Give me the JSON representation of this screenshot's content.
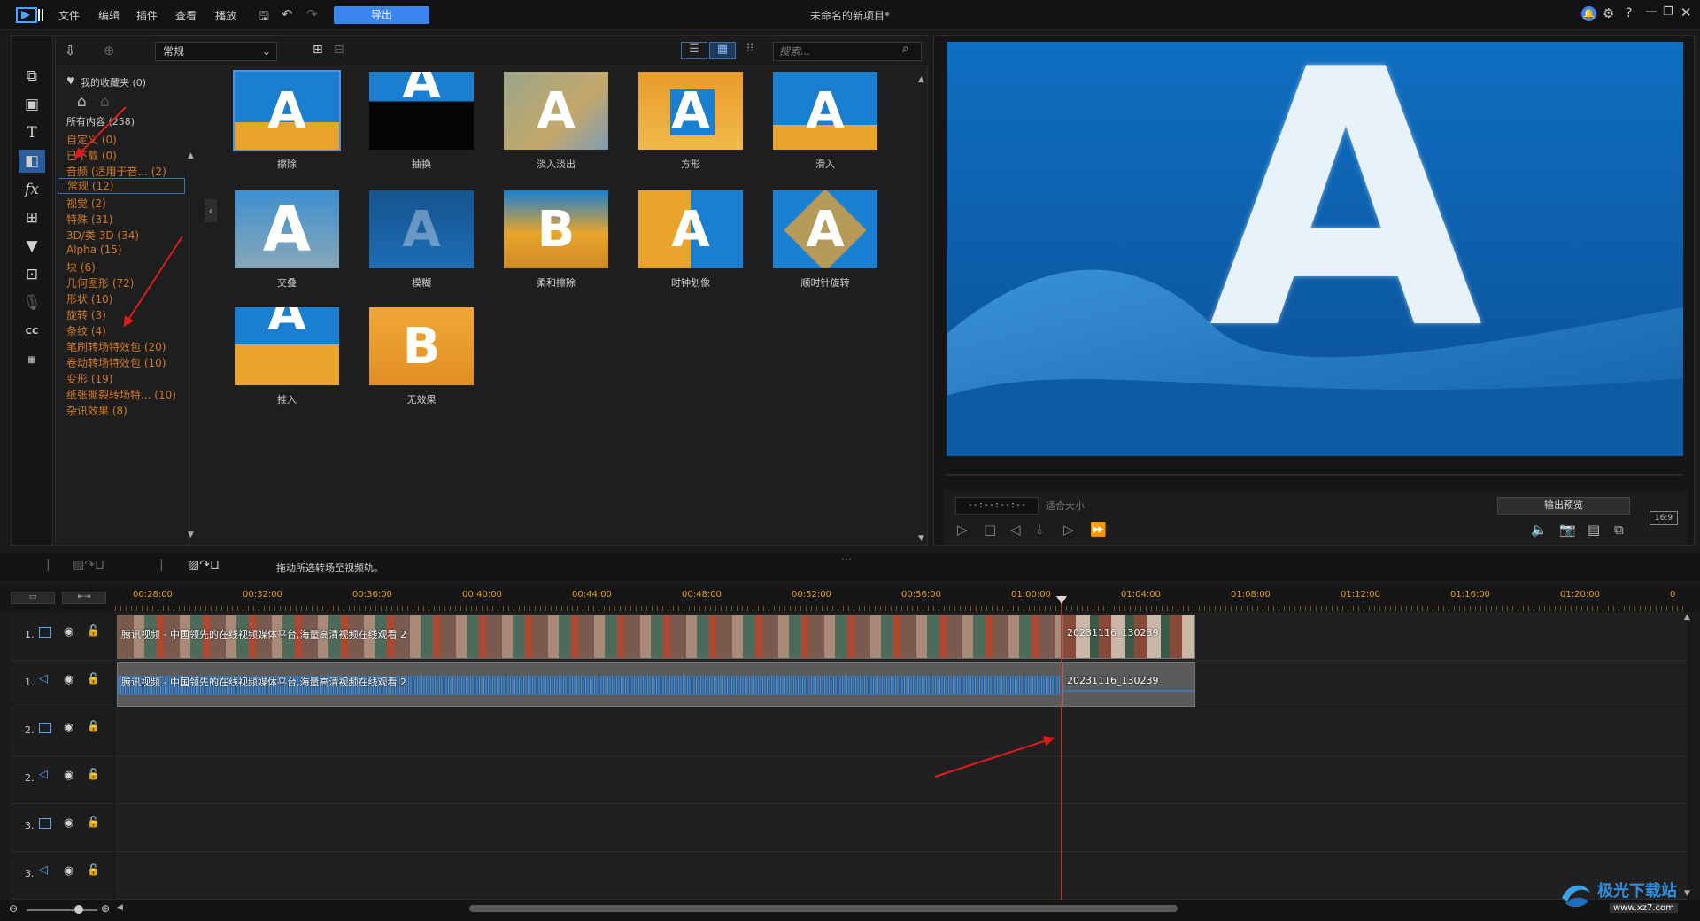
{
  "titlebar": {
    "menu": [
      "文件",
      "编辑",
      "插件",
      "查看",
      "播放"
    ],
    "export_label": "导出",
    "project_title": "未命名的新项目*"
  },
  "library": {
    "category_select": "常规",
    "search_placeholder": "搜索...",
    "favorites": "我的收藏夹 (0)",
    "all_content": "所有内容 (258)",
    "categories": [
      {
        "label": "自定义  (0)"
      },
      {
        "label": "已下载  (0)"
      },
      {
        "label": "音频 (适用于音...  (2)"
      },
      {
        "label": "常规  (12)"
      },
      {
        "label": "视觉  (2)"
      },
      {
        "label": "特殊  (31)"
      },
      {
        "label": "3D/类 3D  (34)"
      },
      {
        "label": "Alpha  (15)"
      },
      {
        "label": "块  (6)"
      },
      {
        "label": "几何图形  (72)"
      },
      {
        "label": "形状  (10)"
      },
      {
        "label": "旋转  (3)"
      },
      {
        "label": "条纹  (4)"
      },
      {
        "label": "笔刷转场特效包  (20)"
      },
      {
        "label": "卷动转场特效包  (10)"
      },
      {
        "label": "变形  (19)"
      },
      {
        "label": "纸张撕裂转场特...  (10)"
      },
      {
        "label": "杂讯效果  (8)"
      }
    ],
    "transitions": [
      {
        "label": "擦除",
        "letter": "A"
      },
      {
        "label": "抽换",
        "letter": "A"
      },
      {
        "label": "淡入淡出",
        "letter": "A"
      },
      {
        "label": "方形",
        "letter": "A"
      },
      {
        "label": "滑入",
        "letter": "A"
      },
      {
        "label": "交叠",
        "letter": "A"
      },
      {
        "label": "模糊",
        "letter": "A"
      },
      {
        "label": "柔和擦除",
        "letter": "B"
      },
      {
        "label": "时钟划像",
        "letter": "A"
      },
      {
        "label": "顺时针旋转",
        "letter": "A"
      },
      {
        "label": "推入",
        "letter": "A"
      },
      {
        "label": "无效果",
        "letter": "B"
      }
    ]
  },
  "preview": {
    "letter": "A",
    "timecode": "--:--:--:--",
    "fit": "适合大小",
    "output_preview": "输出预览",
    "aspect": "16:9"
  },
  "timeline": {
    "hint": "拖动所选转场至视频轨。",
    "ruler": [
      "00:28:00",
      "00:32:00",
      "00:36:00",
      "00:40:00",
      "00:44:00",
      "00:48:00",
      "00:52:00",
      "00:56:00",
      "01:00:00",
      "01:04:00",
      "01:08:00",
      "01:12:00",
      "01:16:00",
      "01:20:00",
      "0"
    ],
    "tracks": [
      {
        "num": "1.",
        "type": "video"
      },
      {
        "num": "1.",
        "type": "audio"
      },
      {
        "num": "2.",
        "type": "video"
      },
      {
        "num": "2.",
        "type": "audio"
      },
      {
        "num": "3.",
        "type": "video"
      },
      {
        "num": "3.",
        "type": "audio"
      }
    ],
    "clips": {
      "video_a": "腾讯视频 - 中国领先的在线视频媒体平台,海量高清视频在线观看 2",
      "video_b": "20231116_130239",
      "audio_a": "腾讯视频 - 中国领先的在线视频媒体平台,海量高清视频在线观看 2",
      "audio_b": "20231116_130239"
    }
  },
  "watermark": {
    "text": "极光下载站",
    "sub": "www.xz7.com"
  }
}
